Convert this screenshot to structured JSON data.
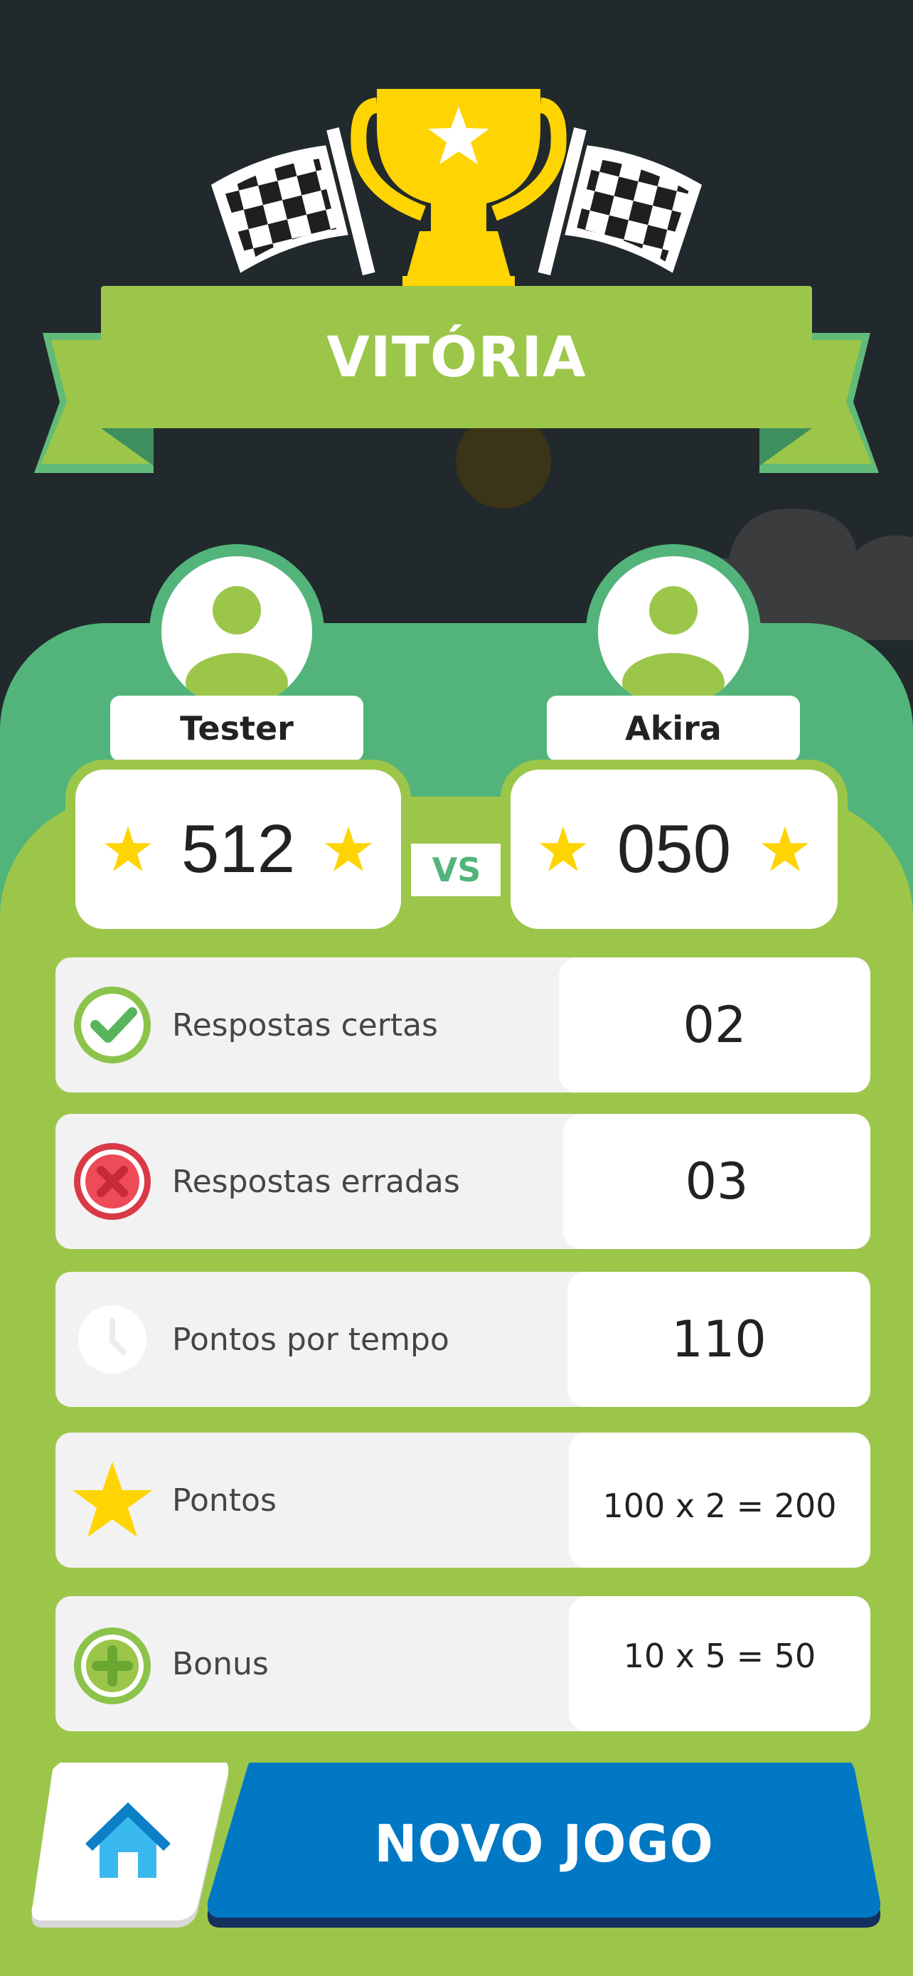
{
  "header": {
    "title": "VITÓRIA"
  },
  "players": [
    {
      "name": "Tester",
      "score": "512"
    },
    {
      "name": "Akira",
      "score": "050"
    }
  ],
  "vs_label": "VS",
  "stats": [
    {
      "icon": "check-circle-icon",
      "label": "Respostas certas",
      "value": "02"
    },
    {
      "icon": "close-circle-icon",
      "label": "Respostas erradas",
      "value": "03"
    },
    {
      "icon": "clock-icon",
      "label": "Pontos por tempo",
      "value": "110"
    },
    {
      "icon": "star-icon",
      "label": "Pontos",
      "value": "100 x 2  =  200"
    },
    {
      "icon": "plus-circle-icon",
      "label": "Bonus",
      "value": "10 x 5  =  50"
    }
  ],
  "buttons": {
    "home_icon": "home-icon",
    "new_game_label": "NOVO JOGO"
  },
  "colors": {
    "background": "#21292c",
    "banner_green": "#9cc64a",
    "panel_green": "#52b47a",
    "trophy_yellow": "#fed402",
    "button_blue": "#0178c4"
  }
}
